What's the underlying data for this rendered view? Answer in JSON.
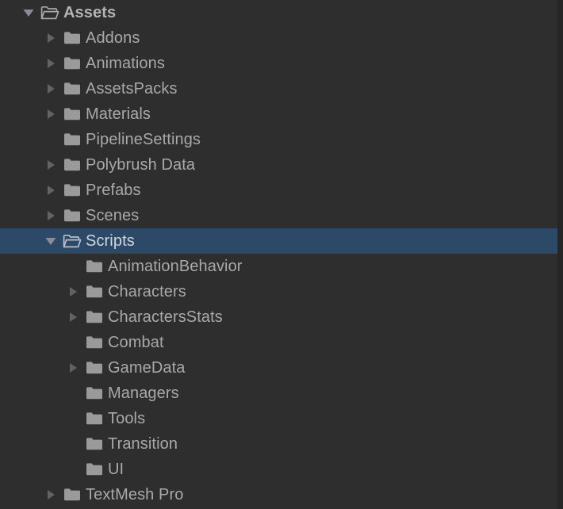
{
  "panel": {
    "name": "Unity Project folder tree",
    "background_color": "#2e2e2e",
    "selection_color": "#2c4a68",
    "text_color": "#a9a9a9",
    "folder_icon_color": "#9a9a9a",
    "arrow_color": "#636363"
  },
  "tree": {
    "rows": [
      {
        "label": "Assets",
        "depth": 0,
        "arrow": "down",
        "icon": "folder-open-icon",
        "selected": false,
        "root": true
      },
      {
        "label": "Addons",
        "depth": 1,
        "arrow": "right",
        "icon": "folder-closed-icon",
        "selected": false,
        "root": false
      },
      {
        "label": "Animations",
        "depth": 1,
        "arrow": "right",
        "icon": "folder-closed-icon",
        "selected": false,
        "root": false
      },
      {
        "label": "AssetsPacks",
        "depth": 1,
        "arrow": "right",
        "icon": "folder-closed-icon",
        "selected": false,
        "root": false
      },
      {
        "label": "Materials",
        "depth": 1,
        "arrow": "right",
        "icon": "folder-closed-icon",
        "selected": false,
        "root": false
      },
      {
        "label": "PipelineSettings",
        "depth": 1,
        "arrow": "none",
        "icon": "folder-closed-icon",
        "selected": false,
        "root": false
      },
      {
        "label": "Polybrush Data",
        "depth": 1,
        "arrow": "right",
        "icon": "folder-closed-icon",
        "selected": false,
        "root": false
      },
      {
        "label": "Prefabs",
        "depth": 1,
        "arrow": "right",
        "icon": "folder-closed-icon",
        "selected": false,
        "root": false
      },
      {
        "label": "Scenes",
        "depth": 1,
        "arrow": "right",
        "icon": "folder-closed-icon",
        "selected": false,
        "root": false
      },
      {
        "label": "Scripts",
        "depth": 1,
        "arrow": "down",
        "icon": "folder-open-icon",
        "selected": true,
        "root": false
      },
      {
        "label": "AnimationBehavior",
        "depth": 2,
        "arrow": "none",
        "icon": "folder-closed-icon",
        "selected": false,
        "root": false
      },
      {
        "label": "Characters",
        "depth": 2,
        "arrow": "right",
        "icon": "folder-closed-icon",
        "selected": false,
        "root": false
      },
      {
        "label": "CharactersStats",
        "depth": 2,
        "arrow": "right",
        "icon": "folder-closed-icon",
        "selected": false,
        "root": false
      },
      {
        "label": "Combat",
        "depth": 2,
        "arrow": "none",
        "icon": "folder-closed-icon",
        "selected": false,
        "root": false
      },
      {
        "label": "GameData",
        "depth": 2,
        "arrow": "right",
        "icon": "folder-closed-icon",
        "selected": false,
        "root": false
      },
      {
        "label": "Managers",
        "depth": 2,
        "arrow": "none",
        "icon": "folder-closed-icon",
        "selected": false,
        "root": false
      },
      {
        "label": "Tools",
        "depth": 2,
        "arrow": "none",
        "icon": "folder-closed-icon",
        "selected": false,
        "root": false
      },
      {
        "label": "Transition",
        "depth": 2,
        "arrow": "none",
        "icon": "folder-closed-icon",
        "selected": false,
        "root": false
      },
      {
        "label": "UI",
        "depth": 2,
        "arrow": "none",
        "icon": "folder-closed-icon",
        "selected": false,
        "root": false
      },
      {
        "label": "TextMesh Pro",
        "depth": 1,
        "arrow": "right",
        "icon": "folder-closed-icon",
        "selected": false,
        "root": false
      }
    ]
  }
}
